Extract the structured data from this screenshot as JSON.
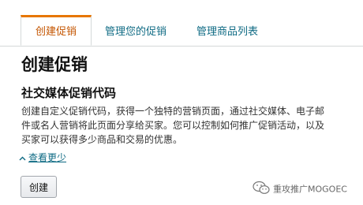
{
  "tabs": [
    {
      "label": "创建促销",
      "active": true
    },
    {
      "label": "管理您的促销",
      "active": false
    },
    {
      "label": "管理商品列表",
      "active": false
    }
  ],
  "page_title": "创建促销",
  "section": {
    "title": "社交媒体促销代码",
    "description_lines": [
      "创建自定义促销代码，获得一个独特的营销页面，通过社交媒体、电子邮",
      "件或名人营销将此页面分享给买家。您可以控制如何推广促销活动，以及",
      "买家可以获得多少商品和交易的优惠。"
    ],
    "see_less_icon": "chevron-up-icon",
    "see_less_label": "查看更少",
    "create_button_label": "创建"
  },
  "watermark": {
    "icon": "wechat-logo-icon",
    "text": "重攻推广MOGOEC"
  },
  "colors": {
    "active_tab_text": "#c45500",
    "active_tab_accent": "#e77600",
    "link": "#0f6b84",
    "border": "#d5d9d9"
  }
}
